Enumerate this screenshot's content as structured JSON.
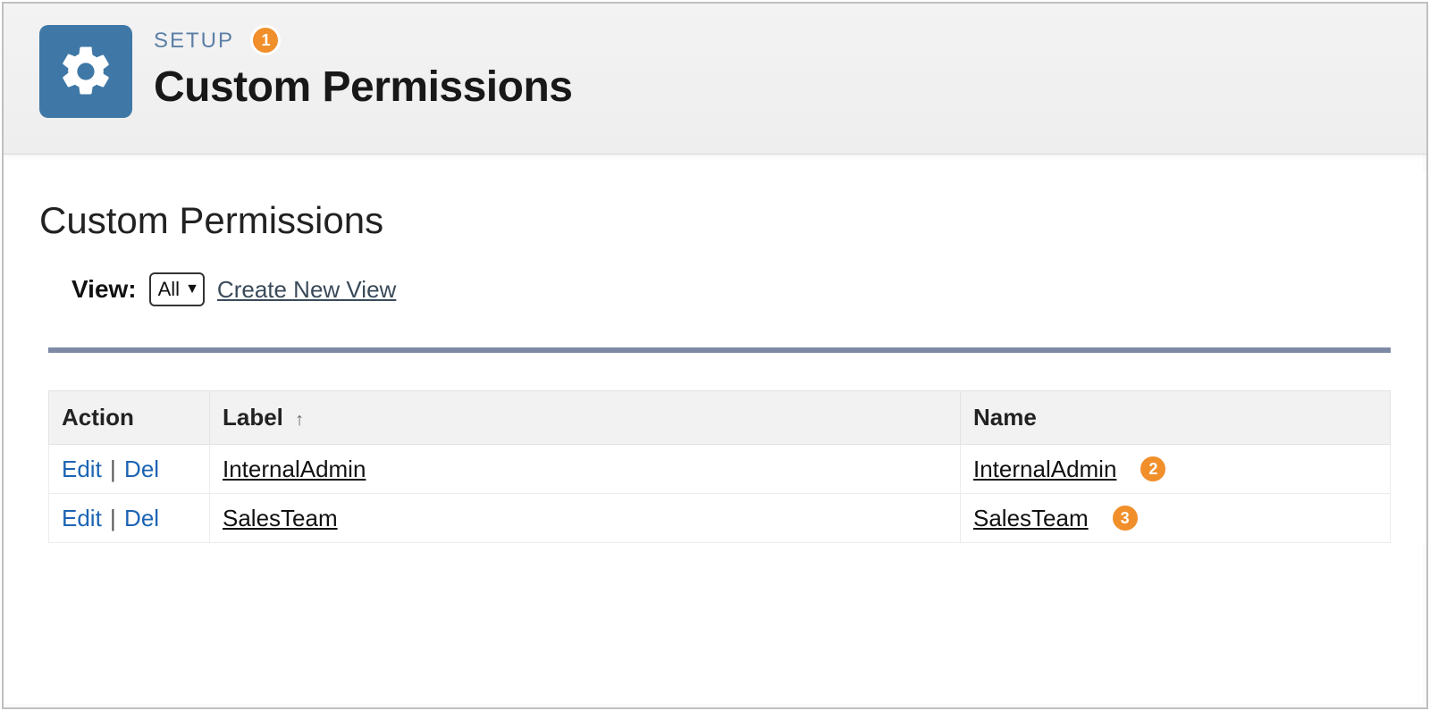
{
  "header": {
    "breadcrumb": "SETUP",
    "title": "Custom Permissions"
  },
  "callouts": {
    "badge1": "1",
    "badge2": "2",
    "badge3": "3"
  },
  "section": {
    "title": "Custom Permissions",
    "view_label": "View:",
    "view_selected": "All",
    "create_view_link": "Create New View"
  },
  "table": {
    "columns": {
      "action": "Action",
      "label": "Label",
      "name": "Name"
    },
    "actions": {
      "edit": "Edit",
      "del": "Del",
      "sep": "|"
    },
    "rows": [
      {
        "label": "InternalAdmin",
        "name": "InternalAdmin"
      },
      {
        "label": "SalesTeam",
        "name": "SalesTeam"
      }
    ]
  }
}
